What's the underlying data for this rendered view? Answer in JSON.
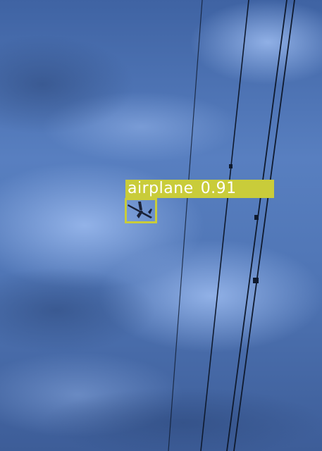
{
  "detection": {
    "class_label": "airplane",
    "confidence": "0.91",
    "box_color": "#c9cc3a"
  },
  "scene": {
    "sky_color": "#5a7fbd",
    "cloud_color": "#8fb0e6",
    "wire_color": "#0f1a2e"
  }
}
